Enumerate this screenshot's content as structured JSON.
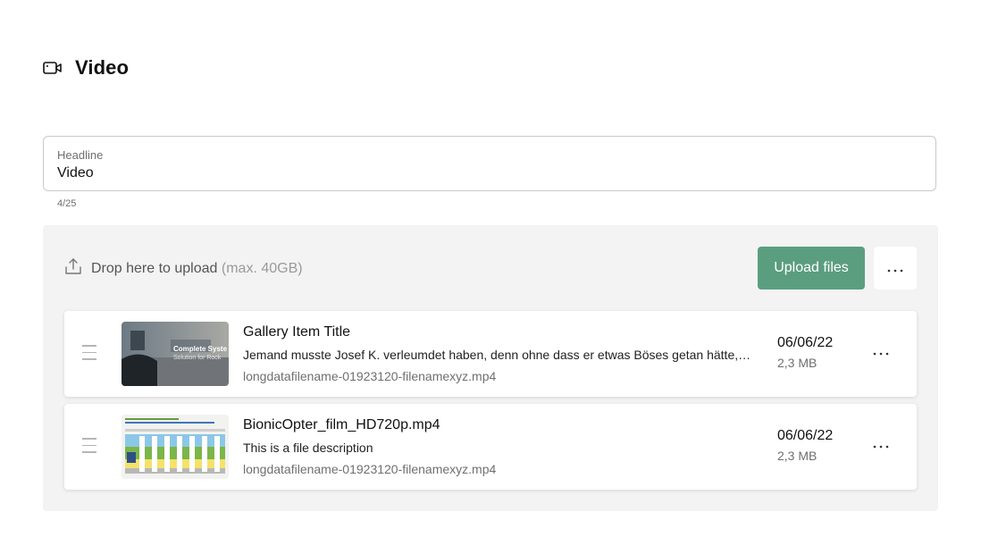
{
  "section": {
    "title": "Video",
    "icon": "video-camera-icon"
  },
  "headline": {
    "label": "Headline",
    "value": "Video",
    "counter": "4/25"
  },
  "upload": {
    "drop_text": "Drop here to upload",
    "drop_hint": "(max. 40GB)",
    "button_label": "Upload files",
    "more_label": "···",
    "accent_color": "#5a9e7f"
  },
  "items": [
    {
      "title": "Gallery Item Title",
      "description": "Jemand musste Josef K. verleumdet haben, denn ohne dass er etwas Böses getan hätte, wurde er eines Morgens verhaftet.",
      "filename": "longdatafilename-01923120-filenamexyz.mp4",
      "date": "06/06/22",
      "size": "2,3 MB",
      "thumb_text": "Complete System\nSolution for Rock",
      "more_label": "···"
    },
    {
      "title": "BionicOpter_film_HD720p.mp4",
      "description": "This is a file description",
      "filename": "longdatafilename-01923120-filenamexyz.mp4",
      "date": "06/06/22",
      "size": "2,3 MB",
      "more_label": "···"
    }
  ]
}
